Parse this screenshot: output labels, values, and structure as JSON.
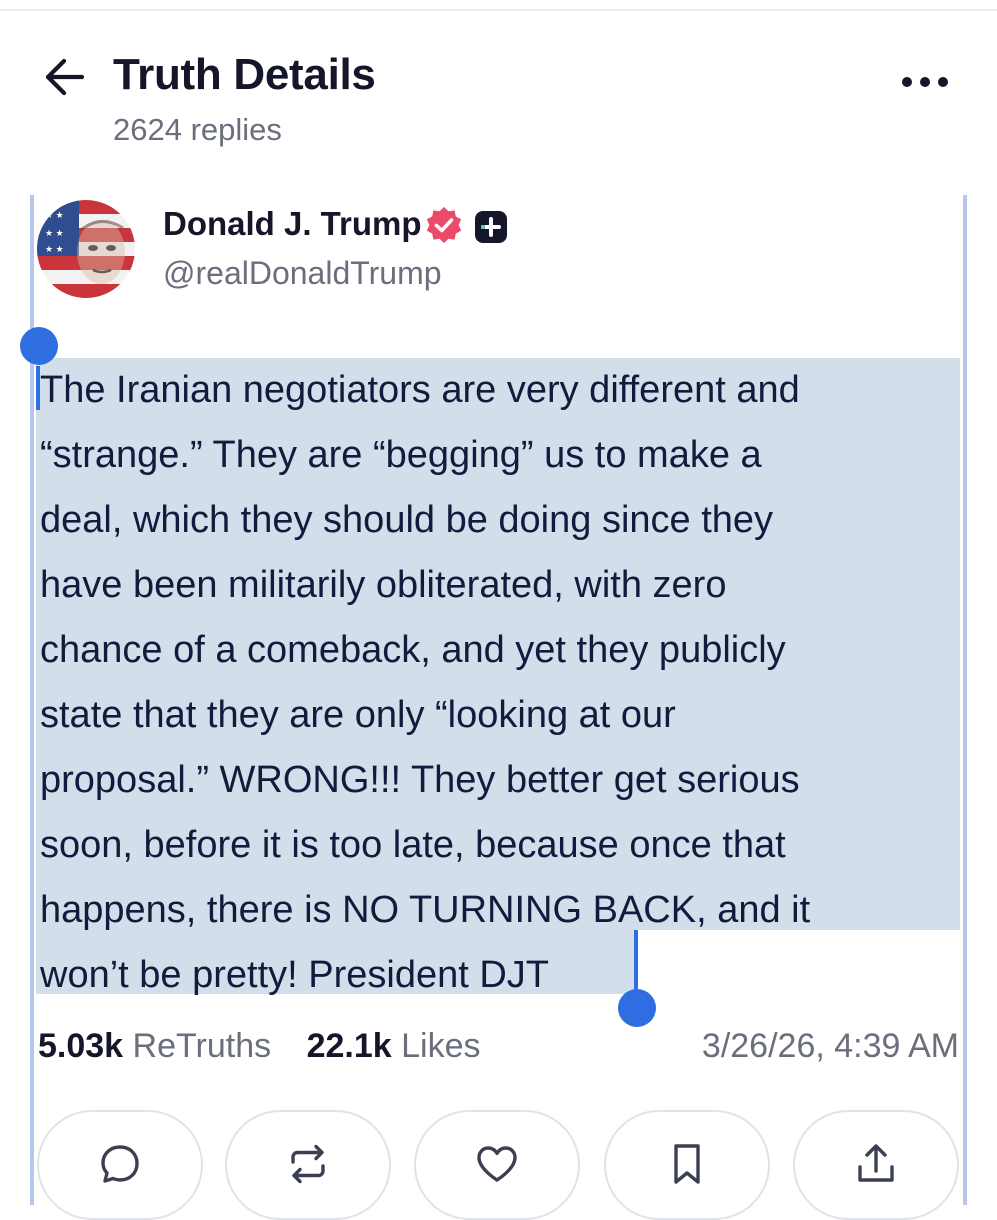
{
  "header": {
    "title": "Truth Details",
    "replies": "2624 replies",
    "back_icon": "arrow-left-icon",
    "more_icon": "more-horizontal-icon"
  },
  "post": {
    "author": {
      "name": "Donald J. Trump",
      "handle": "@realDonaldTrump",
      "verified_badge_color": "#e94b6b",
      "plus_badge_color": "#16162a"
    },
    "lines": [
      "The Iranian negotiators are very different and",
      "“strange.” They are “begging” us to make a",
      "deal, which they should be doing since they",
      "have been militarily obliterated, with zero",
      "chance of a comeback, and yet they publicly",
      "state that they are only “looking at our",
      "proposal.” WRONG!!! They better get serious",
      "soon, before it is too late, because once that",
      "happens, there is NO TURNING BACK, and it",
      "won’t be pretty! President DJT"
    ],
    "selection_color": "#d2deea",
    "handle_color": "#2f6ee0"
  },
  "stats": {
    "retruths_count": "5.03k",
    "retruths_label": "ReTruths",
    "likes_count": "22.1k",
    "likes_label": "Likes",
    "timestamp": "3/26/26, 4:39 AM"
  },
  "actions": [
    {
      "name": "reply",
      "icon": "comment-icon"
    },
    {
      "name": "retruth",
      "icon": "repost-icon"
    },
    {
      "name": "like",
      "icon": "heart-icon"
    },
    {
      "name": "bookmark",
      "icon": "bookmark-icon"
    },
    {
      "name": "share",
      "icon": "share-icon"
    }
  ]
}
